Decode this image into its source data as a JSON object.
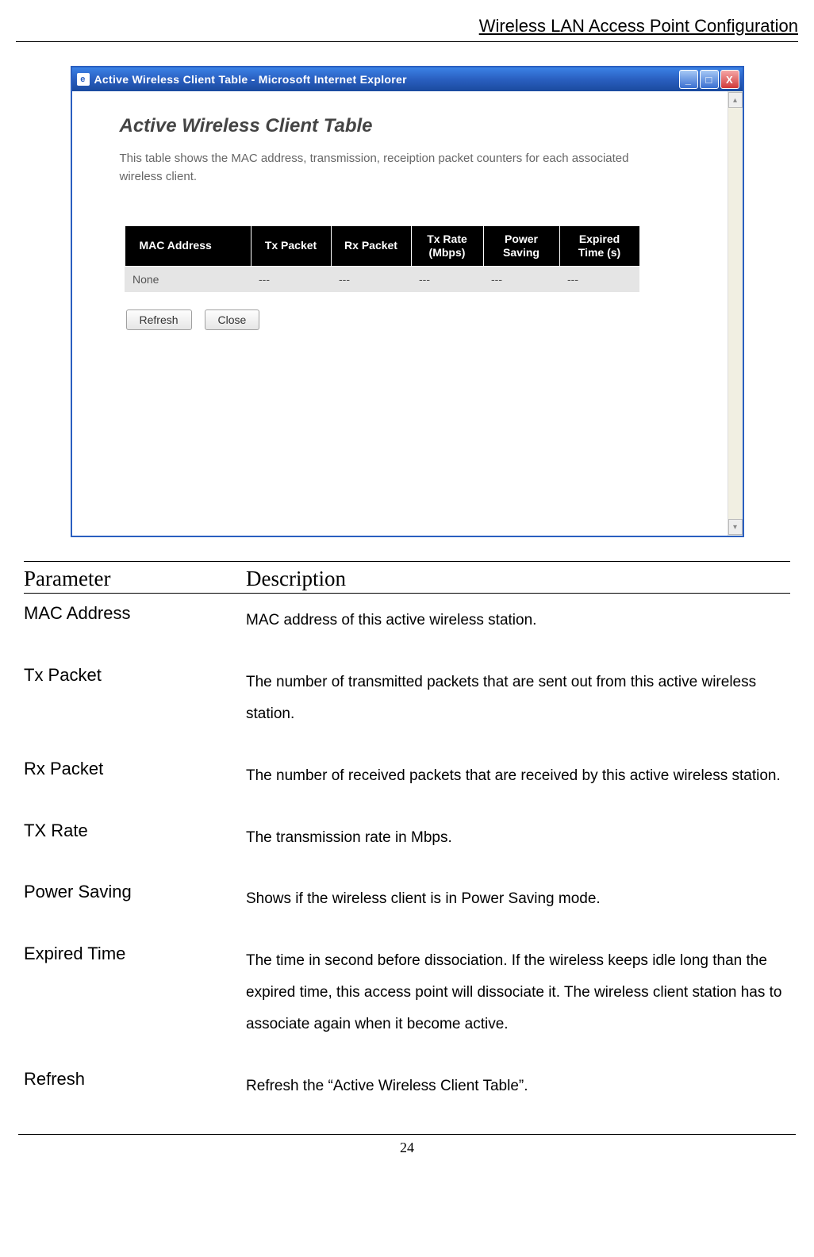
{
  "header": {
    "title": "Wireless LAN Access Point Configuration"
  },
  "ie_window": {
    "title": "Active Wireless Client Table - Microsoft Internet Explorer",
    "icon_label": "e",
    "content": {
      "heading": "Active Wireless Client Table",
      "description": "This table shows the MAC address, transmission, receiption packet counters for each associated wireless client.",
      "columns": {
        "mac": "MAC Address",
        "tx": "Tx Packet",
        "rx": "Rx Packet",
        "rate": "Tx Rate (Mbps)",
        "ps": "Power Saving",
        "exp": "Expired Time (s)"
      },
      "row": {
        "mac": "None",
        "tx": "---",
        "rx": "---",
        "rate": "---",
        "ps": "---",
        "exp": "---"
      },
      "buttons": {
        "refresh": "Refresh",
        "close": "Close"
      }
    },
    "controls": {
      "min": "_",
      "max": "□",
      "close": "X"
    },
    "scroll": {
      "up": "▴",
      "down": "▾"
    }
  },
  "param_table": {
    "header_param": "Parameter",
    "header_desc": "Description",
    "rows": [
      {
        "name": "MAC Address",
        "desc": "MAC address of this active wireless station."
      },
      {
        "name": "Tx Packet",
        "desc": "The number of transmitted packets that are sent out from this active wireless station."
      },
      {
        "name": "Rx Packet",
        "desc": "The number of received packets that are received by this active wireless station."
      },
      {
        "name": "TX Rate",
        "desc": "The transmission rate in Mbps."
      },
      {
        "name": "Power Saving",
        "desc": "Shows if the wireless client is in Power Saving mode."
      },
      {
        "name": "Expired Time",
        "desc": "The time in second before dissociation. If the wireless keeps idle long than the expired time, this access point will dissociate it. The wireless client station has to associate again when it become active."
      },
      {
        "name": "Refresh",
        "desc": "Refresh the “Active Wireless Client Table”."
      }
    ]
  },
  "page_number": "24"
}
